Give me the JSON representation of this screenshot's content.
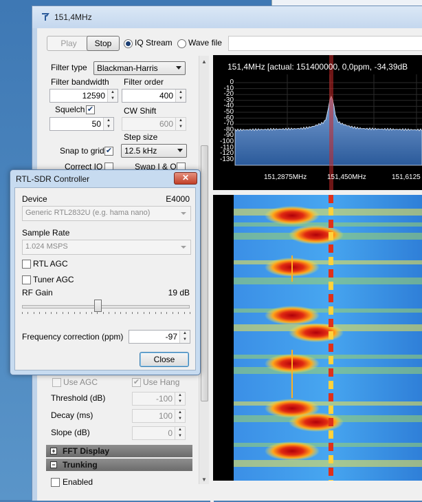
{
  "window": {
    "title": "151,4MHz"
  },
  "toolbar": {
    "play_label": "Play",
    "stop_label": "Stop",
    "iq_stream_label": "IQ Stream",
    "wave_file_label": "Wave file",
    "source_selected": "IQ Stream"
  },
  "panel": {
    "filter_type_label": "Filter type",
    "filter_type_value": "Blackman-Harris",
    "filter_bandwidth_label": "Filter bandwidth",
    "filter_bandwidth_value": "12590",
    "filter_order_label": "Filter order",
    "filter_order_value": "400",
    "squelch_label": "Squelch",
    "squelch_checked": true,
    "squelch_value": "50",
    "cw_shift_label": "CW Shift",
    "cw_shift_value": "600",
    "step_size_label": "Step size",
    "snap_label": "Snap to grid",
    "snap_checked": true,
    "step_size_value": "12.5 kHz",
    "correct_iq_label": "Correct IQ",
    "swap_iq_label": "Swap I & Q",
    "use_agc_label": "Use AGC",
    "use_hang_label": "Use Hang",
    "threshold_label": "Threshold (dB)",
    "threshold_value": "-100",
    "decay_label": "Decay (ms)",
    "decay_value": "100",
    "slope_label": "Slope (dB)",
    "slope_value": "0",
    "fft_display_label": "FFT Display",
    "trunking_label": "Trunking",
    "enabled_label": "Enabled"
  },
  "spectrum": {
    "header": "151,4MHz  [actual: 151400000, 0,0ppm, -34,39dB",
    "y_ticks": [
      "0",
      "-10",
      "-20",
      "-30",
      "-40",
      "-50",
      "-60",
      "-70",
      "-80",
      "-90",
      "-100",
      "-110",
      "-120",
      "-130"
    ],
    "x_ticks": [
      "151,2875MHz",
      "151,450MHz",
      "151,6125"
    ]
  },
  "dialog": {
    "title": "RTL-SDR Controller",
    "close_x": "✕",
    "device_label": "Device",
    "device_tuner": "E4000",
    "device_value": "Generic RTL2832U (e.g. hama nano)",
    "sample_rate_label": "Sample Rate",
    "sample_rate_value": "1.024 MSPS",
    "rtl_agc_label": "RTL AGC",
    "tuner_agc_label": "Tuner AGC",
    "rf_gain_label": "RF Gain",
    "rf_gain_value": "19 dB",
    "rf_gain_fraction": 0.45,
    "freq_corr_label": "Frequency correction (ppm)",
    "freq_corr_value": "-97",
    "close_label": "Close"
  },
  "colors": {
    "accent": "#1b3f73",
    "titlebar": "#c4d7ee",
    "spectrum_fill": "#2a5a9a"
  }
}
